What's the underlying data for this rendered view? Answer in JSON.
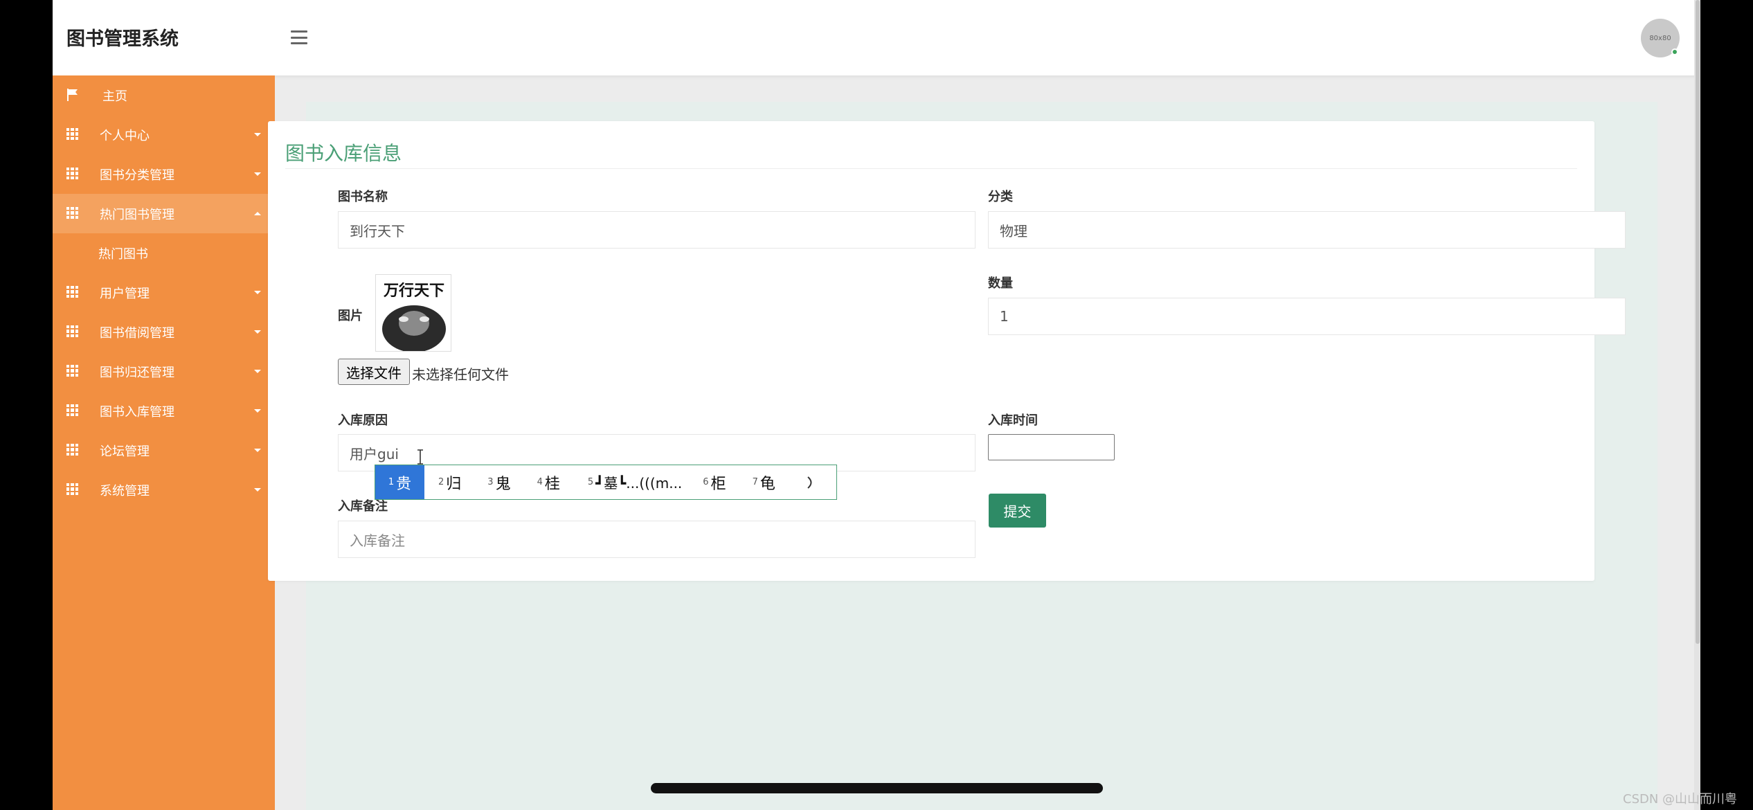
{
  "app": {
    "brand": "图书管理系统",
    "avatar_text": "80x80"
  },
  "sidebar": {
    "items": [
      {
        "label": "主页",
        "icon": "flag-icon"
      },
      {
        "label": "个人中心",
        "icon": "grid-icon"
      },
      {
        "label": "图书分类管理",
        "icon": "grid-icon"
      },
      {
        "label": "热门图书管理",
        "icon": "grid-icon",
        "expanded": true
      },
      {
        "label": "热门图书",
        "sub": true
      },
      {
        "label": "用户管理",
        "icon": "grid-icon"
      },
      {
        "label": "图书借阅管理",
        "icon": "grid-icon"
      },
      {
        "label": "图书归还管理",
        "icon": "grid-icon"
      },
      {
        "label": "图书入库管理",
        "icon": "grid-icon"
      },
      {
        "label": "论坛管理",
        "icon": "grid-icon"
      },
      {
        "label": "系统管理",
        "icon": "grid-icon"
      }
    ]
  },
  "form": {
    "title": "图书入库信息",
    "book_name_label": "图书名称",
    "book_name_value": "到行天下",
    "category_label": "分类",
    "category_value": "物理",
    "image_label": "图片",
    "thumbnail_title": "万行天下",
    "file_button": "选择文件",
    "file_status": "未选择任何文件",
    "quantity_label": "数量",
    "quantity_value": "1",
    "reason_label": "入库原因",
    "reason_value": "用户gui",
    "time_label": "入库时间",
    "remark_label": "入库备注",
    "remark_placeholder": "入库备注",
    "submit": "提交"
  },
  "ime": {
    "candidates": [
      {
        "num": "1",
        "text": "贵",
        "selected": true
      },
      {
        "num": "2",
        "text": "归"
      },
      {
        "num": "3",
        "text": "鬼"
      },
      {
        "num": "4",
        "text": "桂"
      },
      {
        "num": "5",
        "text": "┛墓┗...(((m..."
      },
      {
        "num": "6",
        "text": "柜"
      },
      {
        "num": "7",
        "text": "龟"
      }
    ]
  },
  "watermark": "CSDN @山山而川粤",
  "colors": {
    "sidebar": "#f28f41",
    "accent": "#4a9f76",
    "submit": "#2e8b66",
    "ime_select": "#2f76d8"
  }
}
